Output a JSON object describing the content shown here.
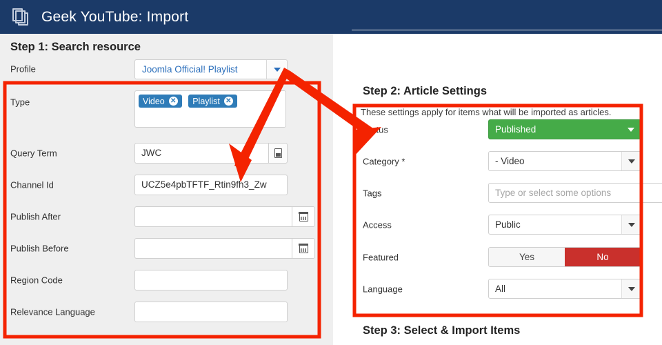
{
  "header": {
    "title": "Geek YouTube: Import",
    "icon": "copy-pages-icon",
    "background": "#1b3a68"
  },
  "left": {
    "step_title": "Step 1: Search resource",
    "profile": {
      "label": "Profile",
      "value": "Joomla Official! Playlist"
    },
    "type": {
      "label": "Type",
      "tags": [
        "Video",
        "Playlist"
      ],
      "tag_color": "#2f7cb8",
      "remove_icon": "remove-circle-icon"
    },
    "query_term": {
      "label": "Query Term",
      "value": "JWC",
      "addon_icon": "insert-value-icon"
    },
    "channel_id": {
      "label": "Channel Id",
      "value": "UCZ5e4pbTFTF_Rtin9fh3_Zw"
    },
    "publish_after": {
      "label": "Publish After",
      "value": "",
      "calendar_icon": "calendar-icon"
    },
    "publish_before": {
      "label": "Publish Before",
      "value": "",
      "calendar_icon": "calendar-icon"
    },
    "region_code": {
      "label": "Region Code",
      "value": ""
    },
    "relevance_language": {
      "label": "Relevance Language",
      "value": ""
    }
  },
  "right": {
    "step2_title": "Step 2: Article Settings",
    "step2_description": "These settings apply for items what will be imported as articles.",
    "step3_title": "Step 3: Select & Import Items",
    "status": {
      "label": "Status",
      "value": "Published",
      "color": "#45ab48"
    },
    "category": {
      "label": "Category *",
      "value": "- Video"
    },
    "tags": {
      "label": "Tags",
      "placeholder": "Type or select some options",
      "value": ""
    },
    "access": {
      "label": "Access",
      "value": "Public"
    },
    "featured": {
      "label": "Featured",
      "yes_label": "Yes",
      "no_label": "No",
      "selected": "No",
      "selected_color": "#c9302c"
    },
    "language": {
      "label": "Language",
      "value": "All"
    }
  },
  "annotations": {
    "highlight_color": "#f42300",
    "boxes": [
      "left-form-highlight",
      "article-settings-highlight"
    ],
    "arrow": "double-headed-arrow"
  }
}
